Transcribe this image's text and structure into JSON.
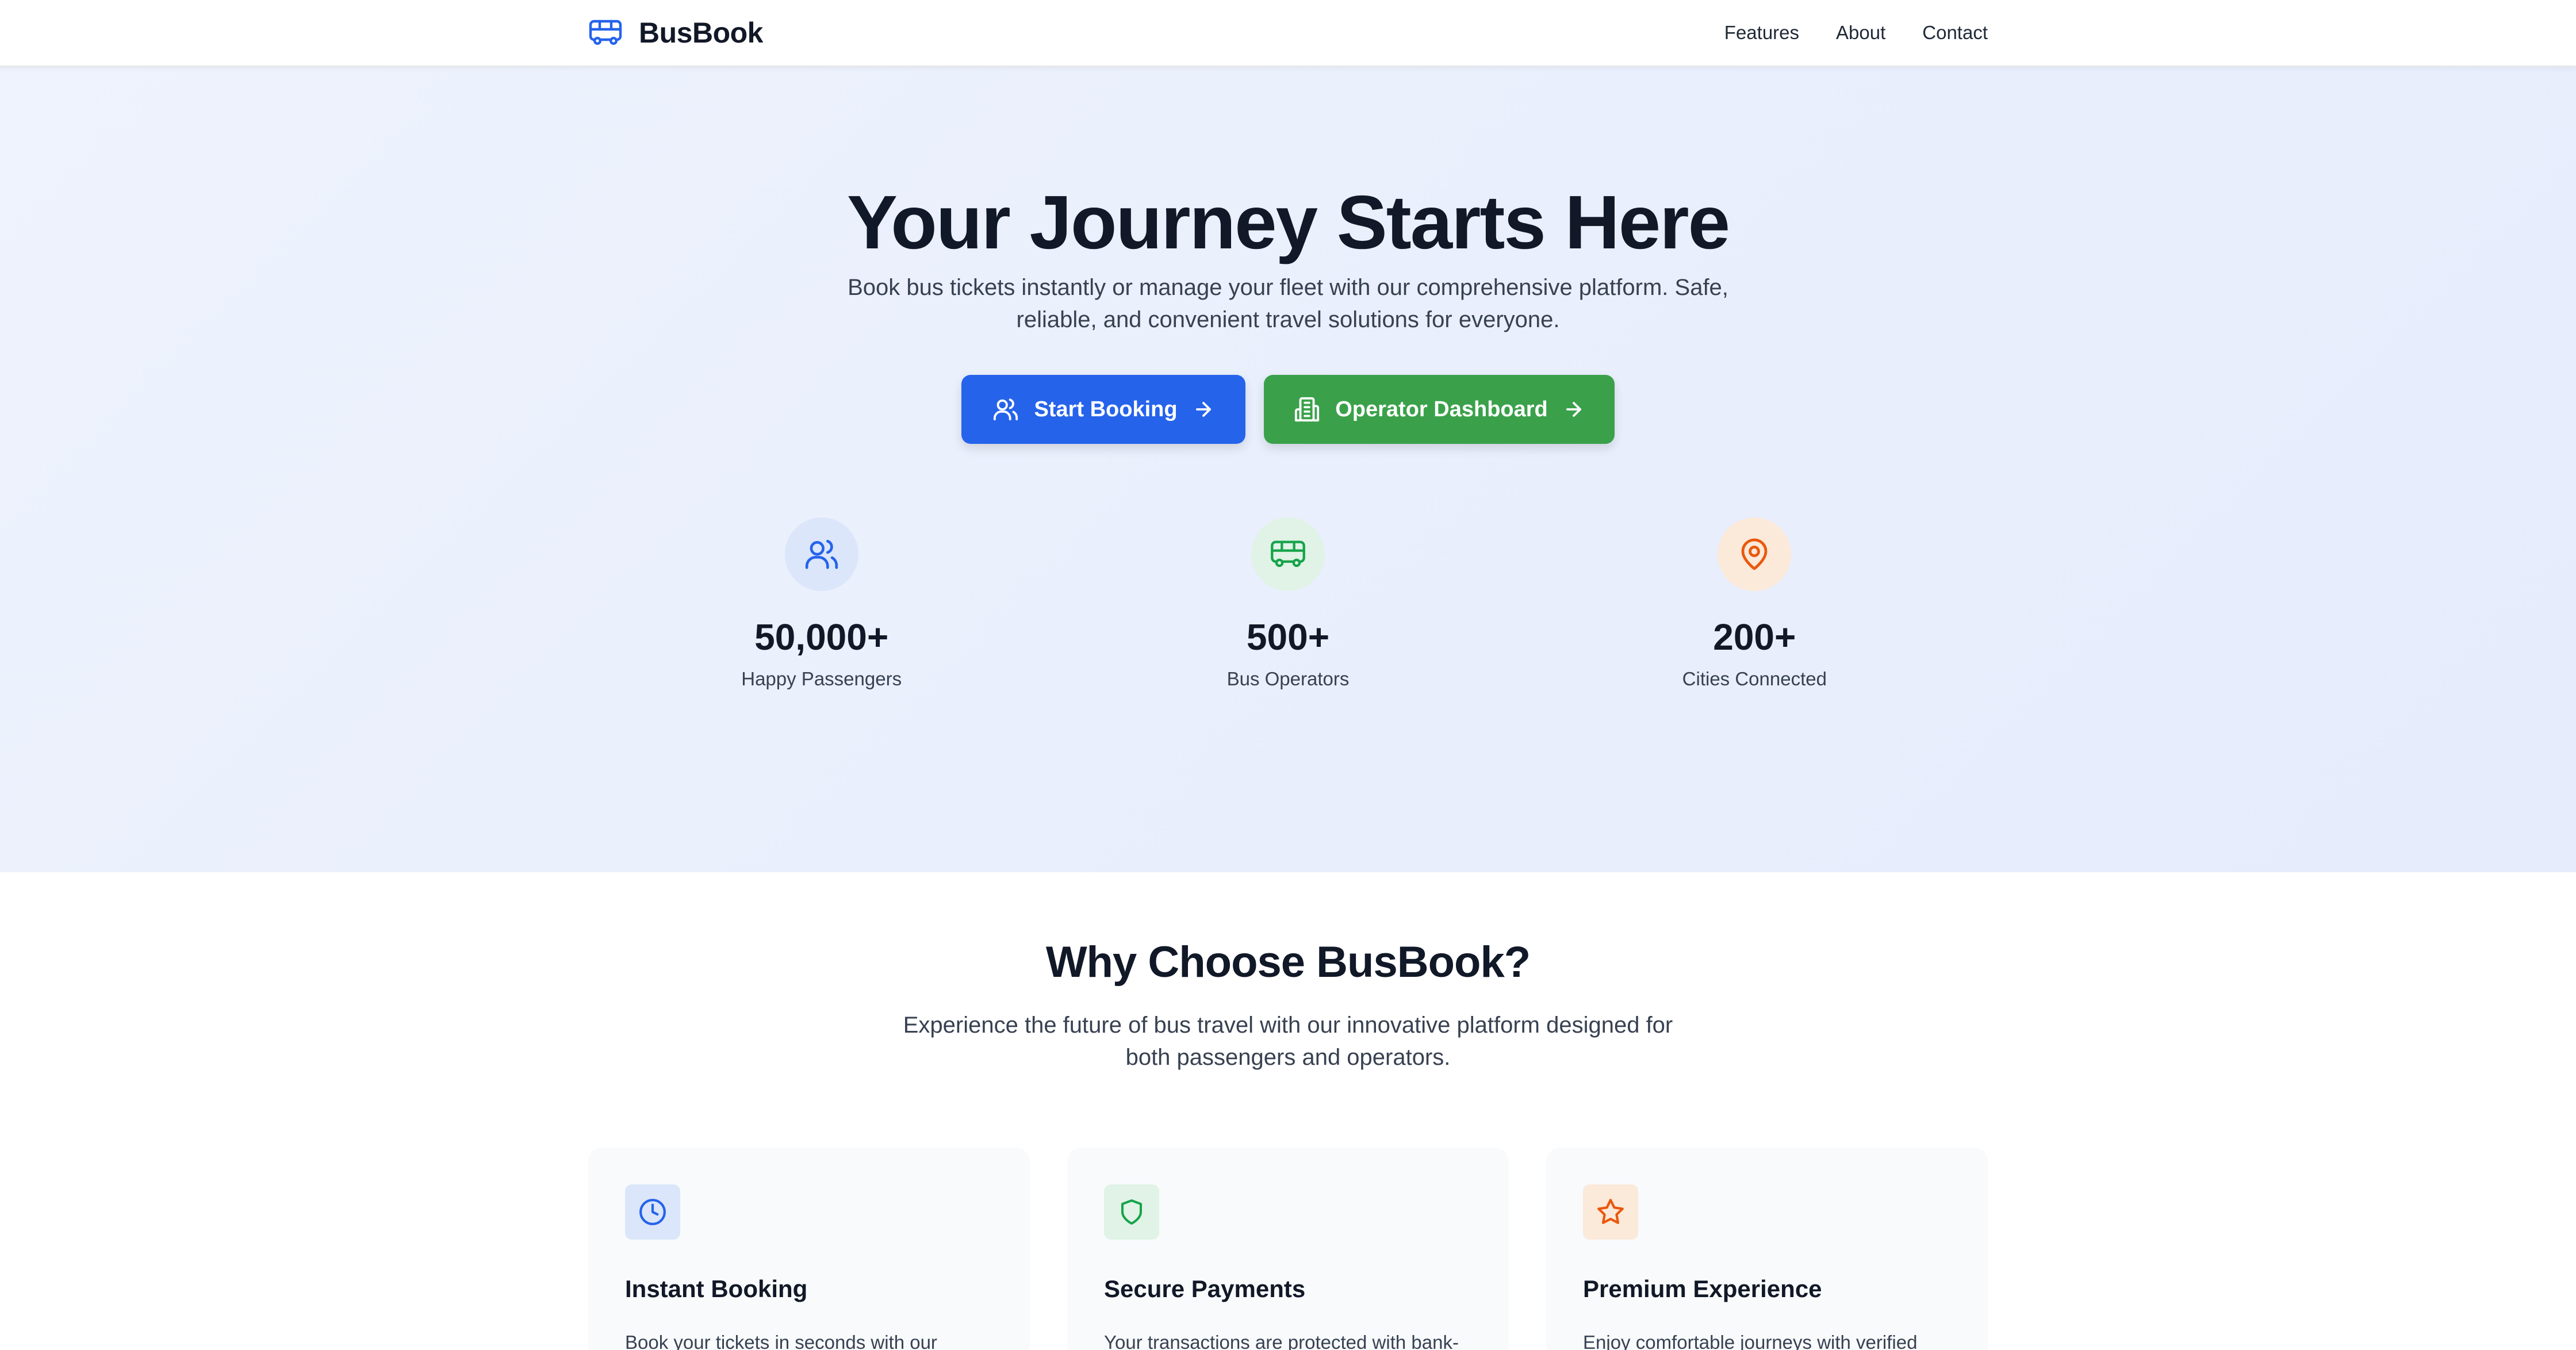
{
  "brand": {
    "name": "BusBook",
    "icon": "bus-icon",
    "accent": "#2563eb"
  },
  "nav": {
    "links": [
      "Features",
      "About",
      "Contact"
    ]
  },
  "hero": {
    "title": "Your Journey Starts Here",
    "subtitle": "Book bus tickets instantly or manage your fleet with our comprehensive platform. Safe, reliable, and convenient travel solutions for everyone.",
    "buttons": [
      {
        "label": "Start Booking",
        "icon": "users-icon",
        "trailing_icon": "arrow-right-icon",
        "color": "#2563eb"
      },
      {
        "label": "Operator Dashboard",
        "icon": "building-icon",
        "trailing_icon": "arrow-right-icon",
        "color": "#3aa14a"
      }
    ]
  },
  "stats": [
    {
      "value": "50,000+",
      "label": "Happy Passengers",
      "icon": "users-icon",
      "color": "#2563eb"
    },
    {
      "value": "500+",
      "label": "Bus Operators",
      "icon": "bus-icon",
      "color": "#16a34a"
    },
    {
      "value": "200+",
      "label": "Cities Connected",
      "icon": "map-pin-icon",
      "color": "#ea580c"
    }
  ],
  "features": {
    "title": "Why Choose BusBook?",
    "subtitle": "Experience the future of bus travel with our innovative platform designed for both passengers and operators.",
    "cards": [
      {
        "title": "Instant Booking",
        "text": "Book your tickets in seconds with our",
        "icon": "clock-icon",
        "color": "#2563eb"
      },
      {
        "title": "Secure Payments",
        "text": "Your transactions are protected with bank-",
        "icon": "shield-icon",
        "color": "#16a34a"
      },
      {
        "title": "Premium Experience",
        "text": "Enjoy comfortable journeys with verified",
        "icon": "star-icon",
        "color": "#ea580c"
      }
    ]
  }
}
